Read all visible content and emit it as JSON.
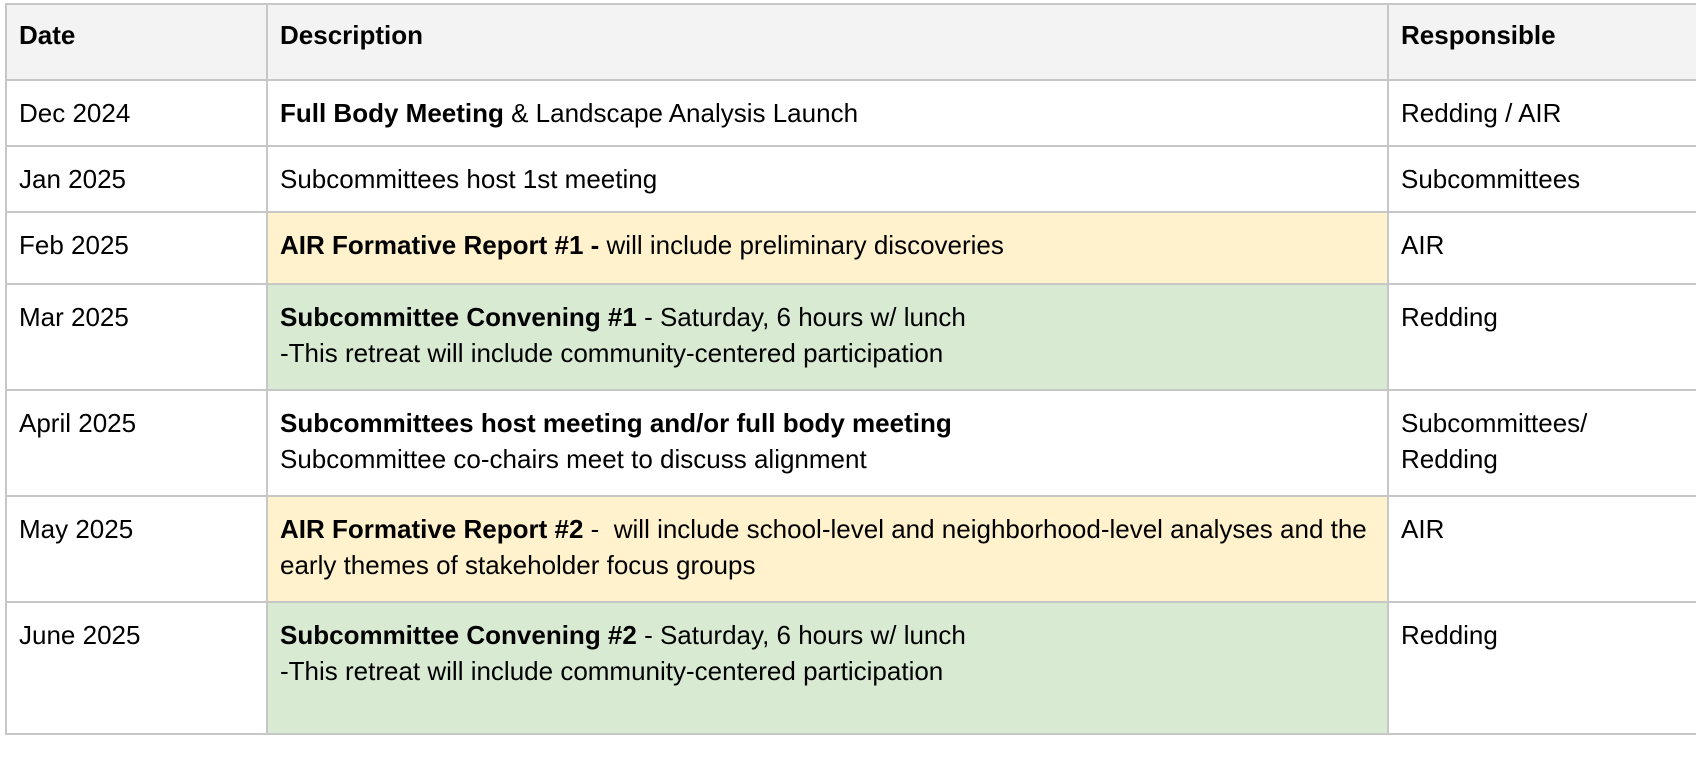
{
  "headers": {
    "date": "Date",
    "description": "Description",
    "responsible": "Responsible"
  },
  "rows": [
    {
      "date": "Dec 2024",
      "desc_bold": "Full Body Meeting",
      "desc_rest": " & Landscape Analysis Launch",
      "desc_line2": "",
      "responsible": "Redding / AIR",
      "highlight": "none"
    },
    {
      "date": "Jan 2025",
      "desc_bold": "",
      "desc_rest": "Subcommittees host 1st meeting",
      "desc_line2": "",
      "responsible": "Subcommittees",
      "highlight": "none"
    },
    {
      "date": "Feb 2025",
      "desc_bold": "AIR Formative Report #1 -",
      "desc_rest": " will include preliminary discoveries",
      "desc_line2": "",
      "responsible": "AIR",
      "highlight": "#fff2cc"
    },
    {
      "date": "Mar 2025",
      "desc_bold": "Subcommittee Convening #1",
      "desc_rest": " - Saturday, 6 hours w/ lunch",
      "desc_line2": "-This retreat will include community-centered participation",
      "responsible": "Redding",
      "highlight": "#d9ead3"
    },
    {
      "date": "April 2025",
      "desc_bold": "Subcommittees host meeting and/or full body meeting",
      "desc_rest": "",
      "desc_line2": "Subcommittee co-chairs meet to discuss alignment",
      "responsible": "Subcommittees/ Redding",
      "highlight": "none"
    },
    {
      "date": "May 2025",
      "desc_bold": "AIR Formative Report #2",
      "desc_rest": " -  will include school-level and neighborhood-level analyses and the early themes of stakeholder focus groups",
      "desc_line2": "",
      "responsible": "AIR",
      "highlight": "#fff2cc"
    },
    {
      "date": "June 2025",
      "desc_bold": "Subcommittee Convening #2",
      "desc_rest": " - Saturday, 6 hours w/ lunch",
      "desc_line2": "-This retreat will include community-centered participation",
      "responsible": "Redding",
      "highlight": "#d9ead3"
    }
  ]
}
